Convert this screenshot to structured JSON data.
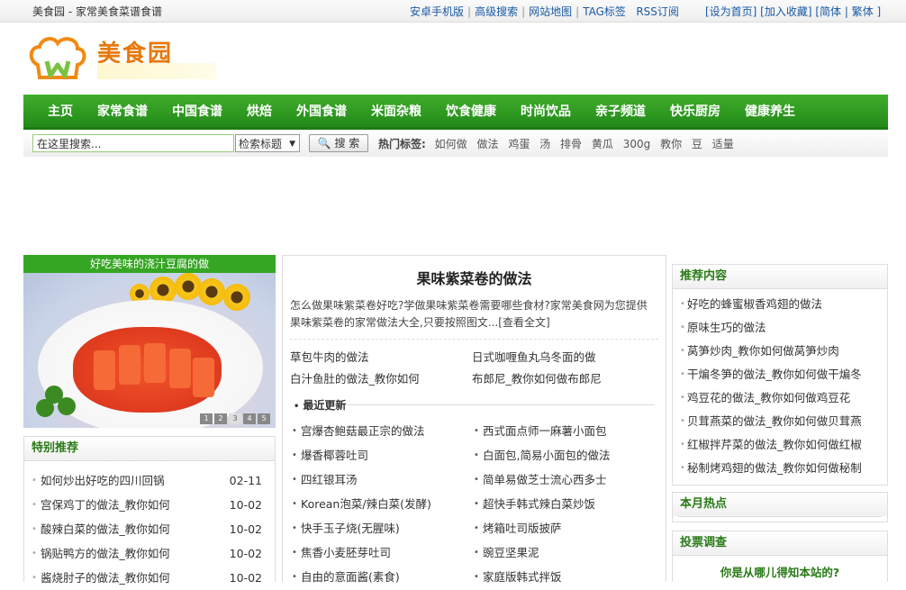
{
  "topbar": {
    "site_tag": "美食园 - 家常美食菜谱食谱",
    "links": [
      "安卓手机版",
      "高级搜索",
      "网站地图",
      "TAG标签",
      "RSS订阅"
    ],
    "right_links": "[设为首页] [加入收藏] [简体 | 繁体 ]"
  },
  "logo": {
    "text": "美食园"
  },
  "nav": [
    "主页",
    "家常食谱",
    "中国食谱",
    "烘焙",
    "外国食谱",
    "米面杂粮",
    "饮食健康",
    "时尚饮品",
    "亲子频道",
    "快乐厨房",
    "健康养生"
  ],
  "search": {
    "placeholder": "在这里搜索...",
    "select_value": "检索标题",
    "button_label": "🔍 搜 索",
    "hot_label": "热门标签:",
    "hot_tags": [
      "如何做",
      "做法",
      "鸡蛋",
      "汤",
      "排骨",
      "黄瓜",
      "300g",
      "教你",
      "豆",
      "适量"
    ]
  },
  "slideshow": {
    "caption": "好吃美味的浇汁豆腐的做",
    "pages": [
      "1",
      "2",
      "3",
      "4",
      "5"
    ]
  },
  "special": {
    "title": "特别推荐",
    "items": [
      {
        "title": "如何炒出好吃的四川回锅",
        "date": "02-11"
      },
      {
        "title": "宫保鸡丁的做法_教你如何",
        "date": "10-02"
      },
      {
        "title": "酸辣白菜的做法_教你如何",
        "date": "10-02"
      },
      {
        "title": "锅贴鸭方的做法_教你如何",
        "date": "10-02"
      },
      {
        "title": "酱烧肘子的做法_教你如何",
        "date": "10-02"
      }
    ]
  },
  "headline": {
    "title": "果味紫菜卷的做法",
    "summary": "怎么做果味紫菜卷好吃?学做果味紫菜卷需要哪些食材?家常美食网为您提供果味紫菜卷的家常做法大全,只要按照图文...",
    "more": "[查看全文]"
  },
  "pairs": [
    [
      "草包牛肉的做法",
      "日式咖喱鱼丸乌冬面的做"
    ],
    [
      "白汁鱼肚的做法_教你如何",
      "布郎尼_教你如何做布郎尼"
    ]
  ],
  "recent": {
    "title": "最近更新",
    "items": [
      "宫爆杏鲍菇最正宗的做法",
      "西式面点师一麻薯小面包",
      "爆香椰蓉吐司",
      "白面包,简易小面包的做法",
      "四红银耳汤",
      "简单易做芝士流心西多士",
      "Korean泡菜/辣白菜(发酵)",
      "超快手韩式辣白菜炒饭",
      "快手玉子烧(无腥味)",
      "烤箱吐司版披萨",
      "焦香小麦胚芽吐司",
      "豌豆坚果泥",
      "自由的意面酱(素食)",
      "家庭版韩式拌饭"
    ]
  },
  "recommend": {
    "title": "推荐内容",
    "items": [
      "好吃的蜂蜜椒香鸡翅的做法",
      "原味生巧的做法",
      "莴笋炒肉_教你如何做莴笋炒肉",
      "干煸冬笋的做法_教你如何做干煸冬",
      "鸡豆花的做法_教你如何做鸡豆花",
      "贝茸燕菜的做法_教你如何做贝茸燕",
      "红椒拌芹菜的做法_教你如何做红椒",
      "秘制烤鸡翅的做法_教你如何做秘制"
    ]
  },
  "hot_month": {
    "title": "本月热点"
  },
  "poll": {
    "title": "投票调查",
    "question": "你是从哪儿得知本站的?"
  }
}
